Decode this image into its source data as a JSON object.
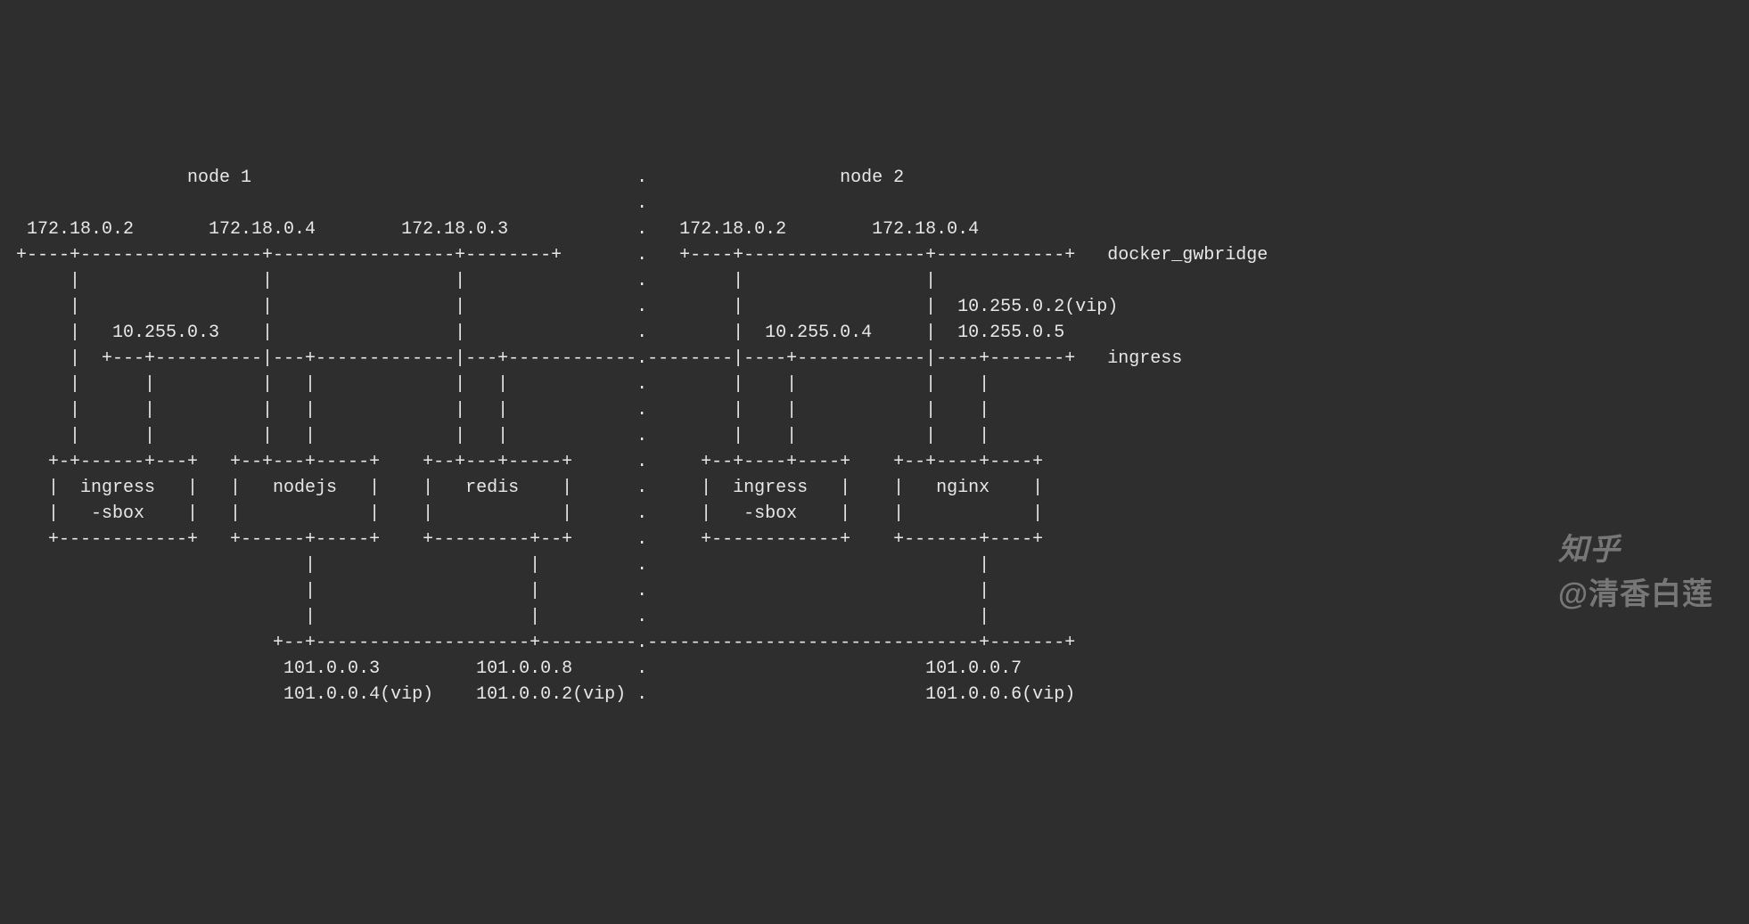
{
  "nodes": {
    "left": {
      "title": "node 1"
    },
    "right": {
      "title": "node 2"
    }
  },
  "networks": {
    "gwbridge": {
      "label": "docker_gwbridge"
    },
    "ingress": {
      "label": "ingress"
    }
  },
  "node1": {
    "gwbridge_ips": [
      "172.18.0.2",
      "172.18.0.4",
      "172.18.0.3"
    ],
    "ingress_ip": "10.255.0.3",
    "containers": {
      "ingress_sbox": {
        "name_line1": "ingress",
        "name_line2": "-sbox"
      },
      "nodejs": {
        "name": "nodejs"
      },
      "redis": {
        "name": "redis"
      }
    },
    "overlay_ips": {
      "nodejs": {
        "ip": "101.0.0.3",
        "vip": "101.0.0.4(vip)"
      },
      "redis": {
        "ip": "101.0.0.8",
        "vip": "101.0.0.2(vip)"
      }
    }
  },
  "node2": {
    "gwbridge_ips": [
      "172.18.0.2",
      "172.18.0.4"
    ],
    "ingress_ip": "10.255.0.4",
    "ingress_vip_lines": [
      "10.255.0.2(vip)",
      "10.255.0.5"
    ],
    "containers": {
      "ingress_sbox": {
        "name_line1": "ingress",
        "name_line2": "-sbox"
      },
      "nginx": {
        "name": "nginx"
      }
    },
    "overlay_ips": {
      "nginx": {
        "ip": "101.0.0.7",
        "vip": "101.0.0.6(vip)"
      }
    }
  },
  "watermark": {
    "logo": "知乎",
    "author": "@清香白莲"
  }
}
